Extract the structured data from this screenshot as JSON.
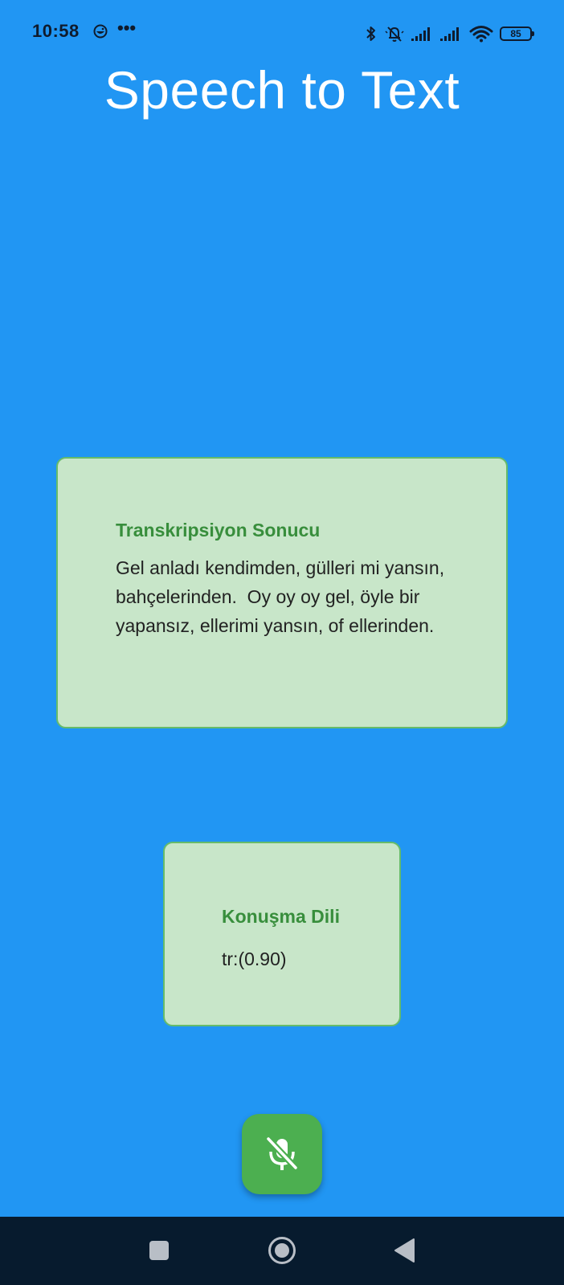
{
  "status_bar": {
    "time": "10:58",
    "overflow_dots": "•••",
    "battery_level": "85",
    "icons": [
      "face-notification-icon",
      "bluetooth-icon",
      "bell-off-icon",
      "signal-1-icon",
      "signal-2-icon",
      "wifi-icon",
      "battery-icon"
    ]
  },
  "app": {
    "title": "Speech to Text"
  },
  "transcript_card": {
    "heading": "Transkripsiyon Sonucu",
    "text": "Gel anladı kendimden, gülleri mi yansın, bahçelerinden.  Oy oy oy gel, öyle bir yapansız, ellerimi yansın, of ellerinden."
  },
  "language_card": {
    "heading": "Konuşma Dili",
    "value": "tr:(0.90)"
  },
  "mic_button": {
    "icon": "mic-off-icon",
    "state": "off"
  },
  "nav_bar": {
    "icons": [
      "recents-icon",
      "home-icon",
      "back-icon"
    ]
  },
  "colors": {
    "background": "#2196F3",
    "card_bg": "#C8E6C9",
    "card_border": "#66BB6A",
    "heading": "#388E3C",
    "fab": "#4CAF50",
    "nav_bar": "#071B2E"
  }
}
